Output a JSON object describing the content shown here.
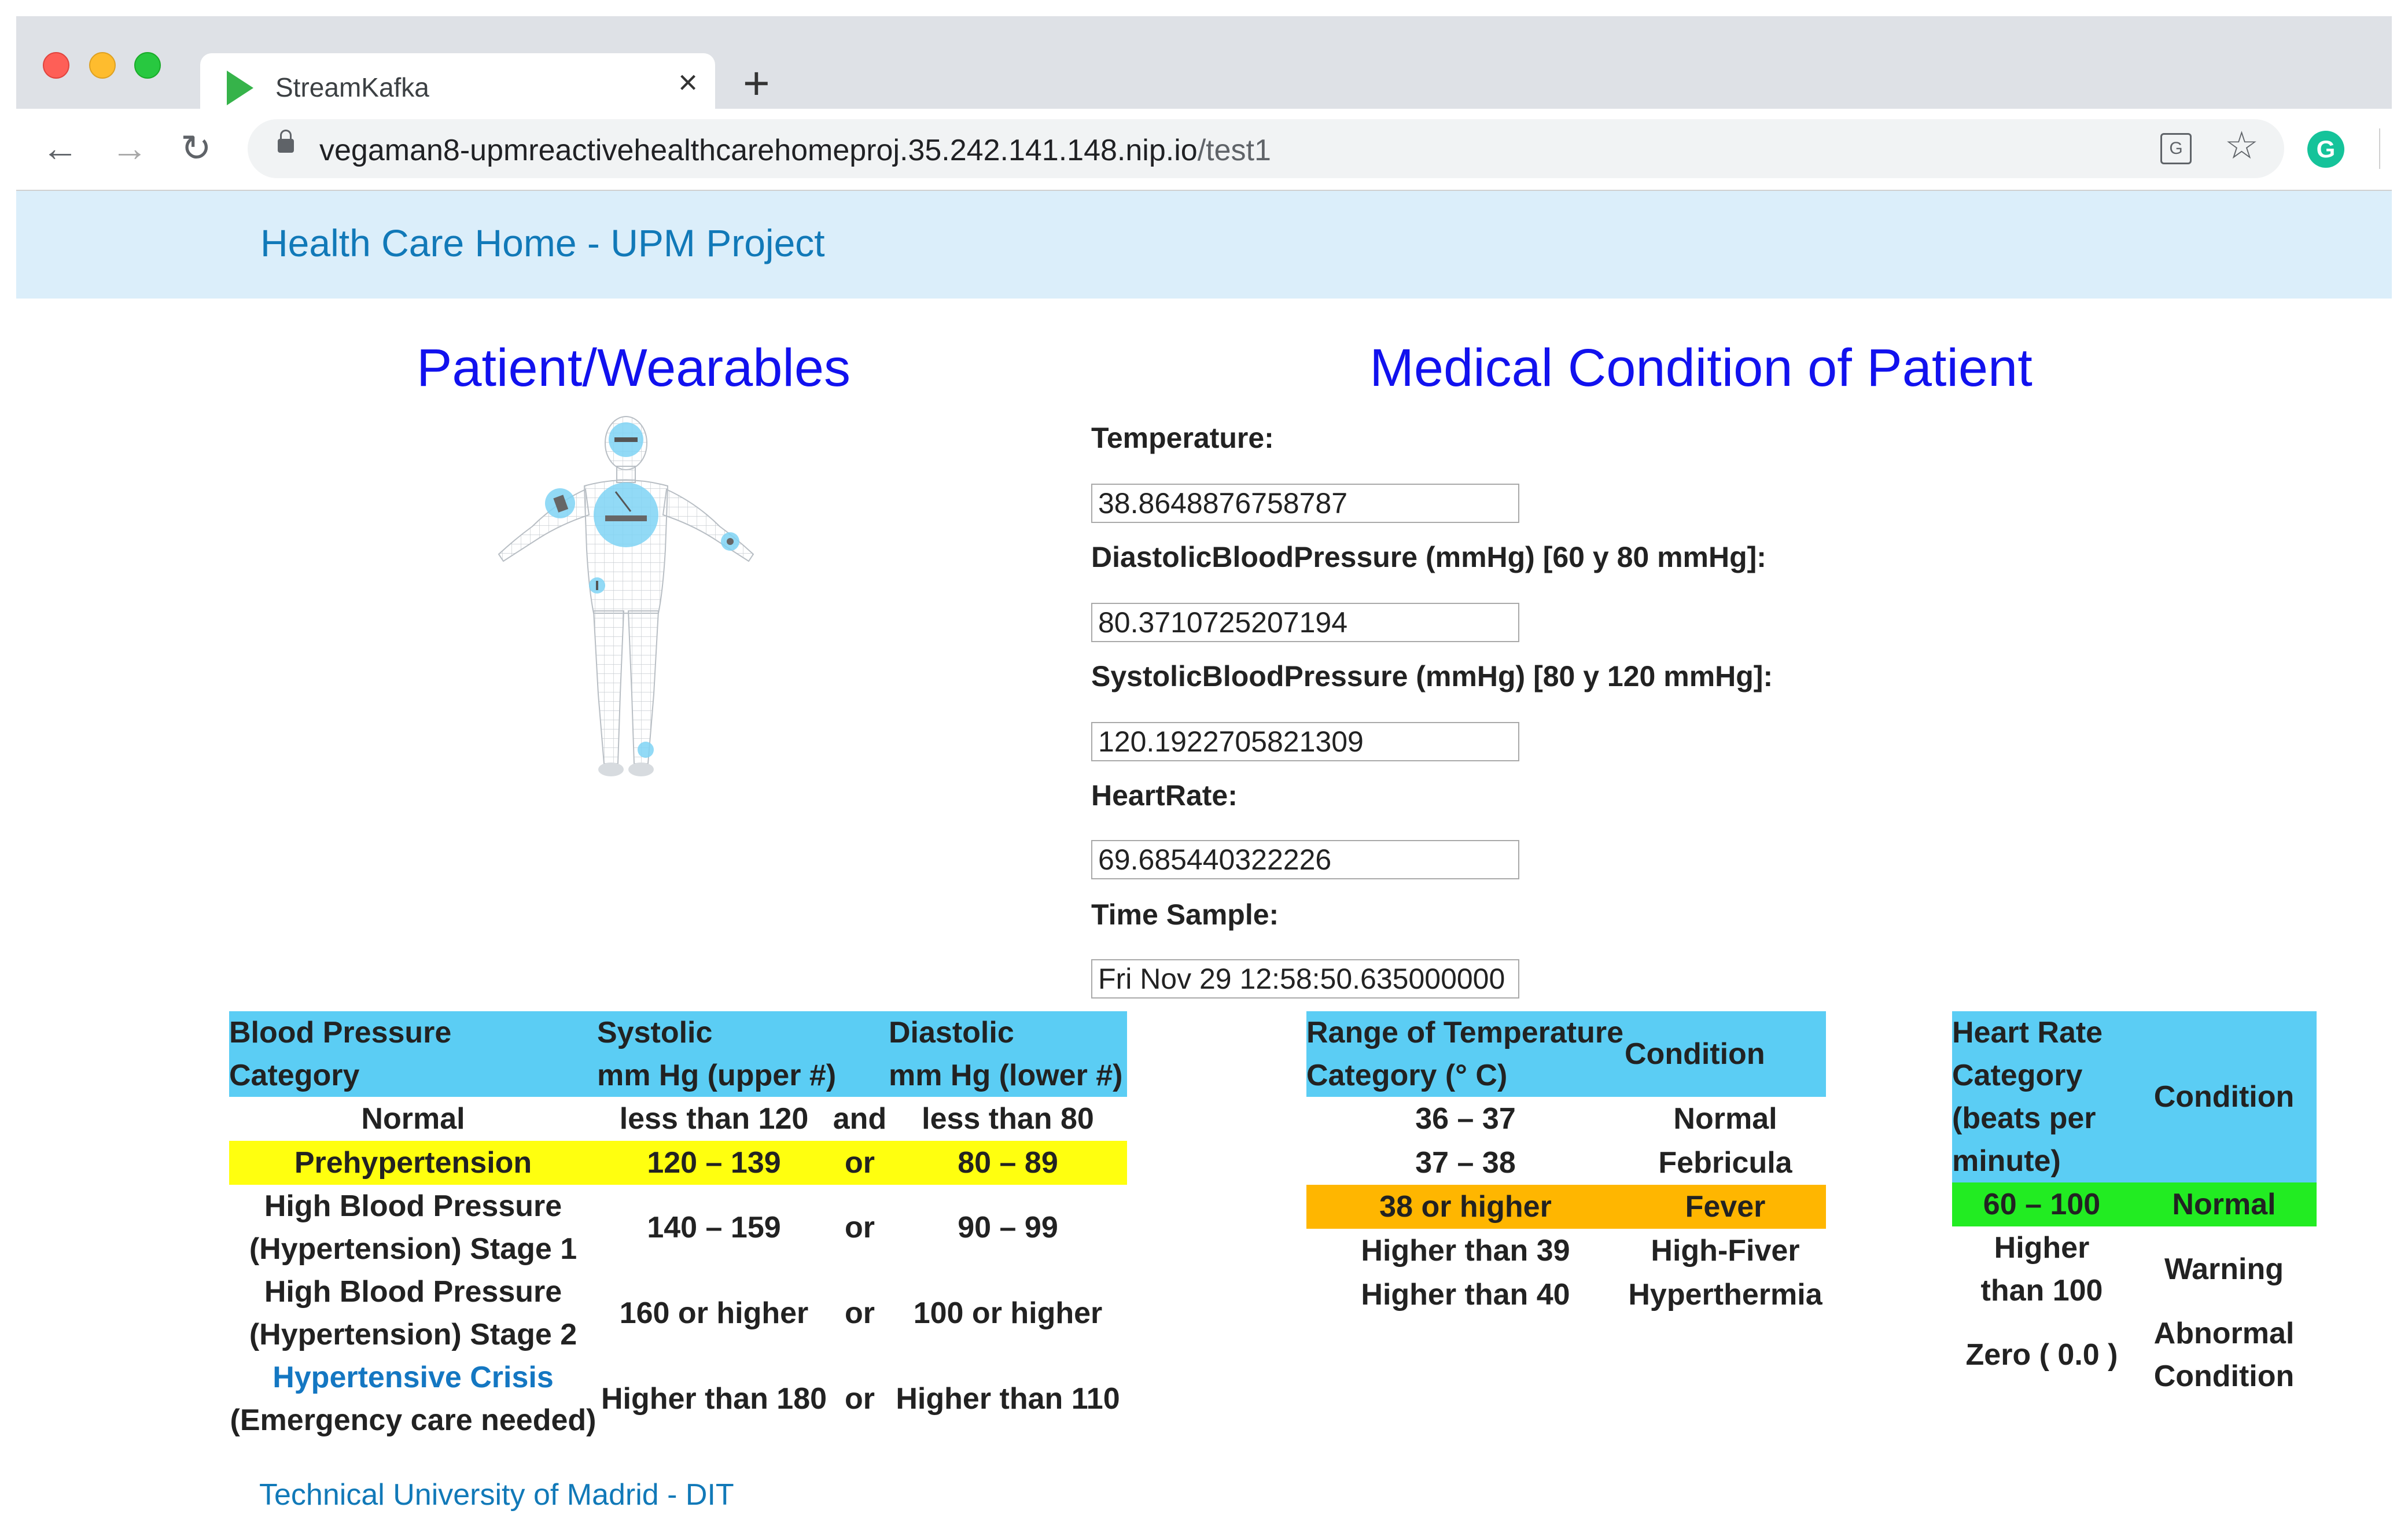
{
  "browser": {
    "tab_title": "StreamKafka",
    "url_host": "vegaman8-upmreactivehealthcarehomeproj.35.242.141.148.nip.io",
    "url_path": "/test1",
    "icons": [
      "back-arrow-icon",
      "forward-arrow-icon",
      "reload-icon",
      "lock-icon",
      "translate-icon",
      "star-icon",
      "grammarly-icon",
      "close-icon",
      "plus-icon"
    ]
  },
  "app": {
    "brand": "Health Care Home - UPM Project"
  },
  "left_panel": {
    "title": "Patient/Wearables"
  },
  "right_panel": {
    "title": "Medical Condition of Patient",
    "fields": {
      "temperature": {
        "label": "Temperature:",
        "value": "38.8648876758787"
      },
      "diastolic": {
        "label": "DiastolicBloodPressure (mmHg) [60 y 80 mmHg]:",
        "value": "80.3710725207194"
      },
      "systolic": {
        "label": "SystolicBloodPressure (mmHg) [80 y 120 mmHg]:",
        "value": "120.1922705821309"
      },
      "heart_rate": {
        "label": "HeartRate:",
        "value": "69.685440322226"
      },
      "time_sample": {
        "label": "Time Sample:",
        "value": "Fri Nov 29 12:58:50.635000000"
      }
    }
  },
  "bp_table": {
    "headers": {
      "category_l1": "Blood Pressure",
      "category_l2": "Category",
      "systolic_l1": "Systolic",
      "systolic_l2": "mm Hg (upper #)",
      "diastolic_l1": "Diastolic",
      "diastolic_l2": "mm Hg (lower #)"
    },
    "rows": [
      {
        "cat_l1": "Normal",
        "cat_l2": "",
        "sys": "less than 120",
        "op": "and",
        "dia": "less than 80"
      },
      {
        "cat_l1": "Prehypertension",
        "cat_l2": "",
        "sys": "120 – 139",
        "op": "or",
        "dia": "80 – 89"
      },
      {
        "cat_l1": "High Blood Pressure",
        "cat_l2": "(Hypertension) Stage 1",
        "sys": "140 – 159",
        "op": "or",
        "dia": "90 – 99"
      },
      {
        "cat_l1": "High Blood Pressure",
        "cat_l2": "(Hypertension) Stage 2",
        "sys": "160 or higher",
        "op": "or",
        "dia": "100 or higher"
      },
      {
        "cat_l1": "Hypertensive Crisis",
        "cat_l2": "(Emergency care needed)",
        "sys": "Higher than 180",
        "op": "or",
        "dia": "Higher than 110"
      }
    ],
    "colors": {
      "header": "#5bcdf4",
      "prehypertension": "#ffff0f",
      "crisis_text": "#1477c2"
    }
  },
  "temp_table": {
    "headers": {
      "range_l1": "Range of Temperature",
      "range_l2": "Category (° C)",
      "condition": "Condition"
    },
    "rows": [
      {
        "range": "36 – 37",
        "cond": "Normal"
      },
      {
        "range": "37 – 38",
        "cond": "Febricula"
      },
      {
        "range": "38 or higher",
        "cond": "Fever"
      },
      {
        "range": "Higher than 39",
        "cond": "High-Fiver"
      },
      {
        "range": "Higher than 40",
        "cond": "Hyperthermia"
      }
    ],
    "colors": {
      "fever": "#ffb600"
    }
  },
  "hr_table": {
    "headers": {
      "cat_l1": "Heart Rate",
      "cat_l2": "Category",
      "cat_l3": "(beats per",
      "cat_l4": "minute)",
      "condition": "Condition"
    },
    "rows": [
      {
        "cat_l1": "60 – 100",
        "cat_l2": "",
        "cond_l1": "Normal",
        "cond_l2": ""
      },
      {
        "cat_l1": "Higher",
        "cat_l2": "than 100",
        "cond_l1": "Warning",
        "cond_l2": ""
      },
      {
        "cat_l1": "Zero ( 0.0 )",
        "cat_l2": "",
        "cond_l1": "Abnormal",
        "cond_l2": "Condition"
      }
    ],
    "colors": {
      "normal": "#22ec22"
    }
  },
  "footer": {
    "link": "Technical University of Madrid - DIT"
  }
}
